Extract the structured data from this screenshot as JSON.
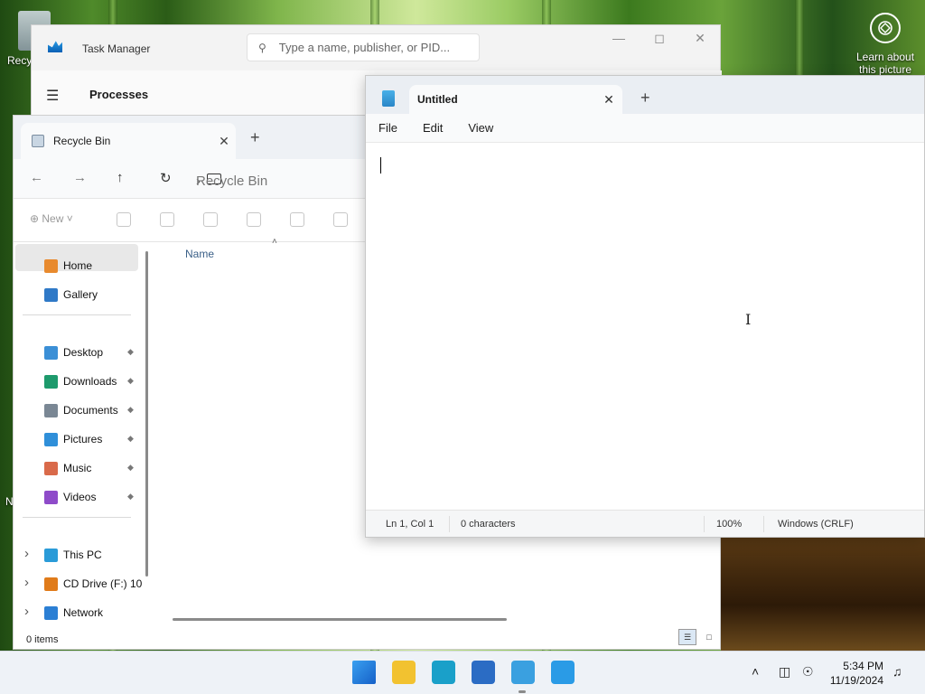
{
  "desktop": {
    "recycle_icon_label": "Recy",
    "spotlight_label": "Learn about this picture",
    "left_edge_letter": "N"
  },
  "task_manager": {
    "title": "Task Manager",
    "search_placeholder": "Type a name, publisher, or PID...",
    "nav_section": "Processes"
  },
  "explorer": {
    "tab_title": "Recycle Bin",
    "breadcrumb": "Recycle Bin",
    "new_label": "New",
    "sidebar": {
      "top": [
        {
          "label": "Home",
          "icon": "home-icon",
          "color": "#e88a2e"
        },
        {
          "label": "Gallery",
          "icon": "gallery-icon",
          "color": "#2f79c7"
        }
      ],
      "pinned": [
        {
          "label": "Desktop",
          "icon": "desktop-icon",
          "color": "#3b8fd6"
        },
        {
          "label": "Downloads",
          "icon": "downloads-icon",
          "color": "#1d9a6c"
        },
        {
          "label": "Documents",
          "icon": "documents-icon",
          "color": "#7a8794"
        },
        {
          "label": "Pictures",
          "icon": "pictures-icon",
          "color": "#2f8fd9"
        },
        {
          "label": "Music",
          "icon": "music-icon",
          "color": "#d96a4a"
        },
        {
          "label": "Videos",
          "icon": "videos-icon",
          "color": "#8e4bc9"
        }
      ],
      "drives": [
        {
          "label": "This PC",
          "icon": "this-pc-icon",
          "color": "#2a9bd8"
        },
        {
          "label": "CD Drive (F:) 10",
          "icon": "cd-drive-icon",
          "color": "#e07b1a"
        },
        {
          "label": "Network",
          "icon": "network-icon",
          "color": "#2b7fd4"
        }
      ]
    },
    "column_name": "Name",
    "status_items": "0 items"
  },
  "notepad": {
    "tab_title": "Untitled",
    "menu": [
      "File",
      "Edit",
      "View"
    ],
    "status": {
      "position": "Ln 1, Col 1",
      "characters": "0 characters",
      "zoom": "100%",
      "line_endings": "Windows (CRLF)"
    }
  },
  "taskbar": {
    "time": "5:34 PM",
    "date": "11/19/2024",
    "apps": [
      {
        "name": "start-button",
        "color": "#1d7fd8"
      },
      {
        "name": "file-explorer-taskbar",
        "color": "#f2c230"
      },
      {
        "name": "edge-taskbar",
        "color": "#1aa0c9"
      },
      {
        "name": "store-taskbar",
        "color": "#2b6cc4"
      },
      {
        "name": "notepad-taskbar",
        "color": "#3aa0e0"
      },
      {
        "name": "task-manager-taskbar",
        "color": "#2a9be6"
      }
    ]
  }
}
